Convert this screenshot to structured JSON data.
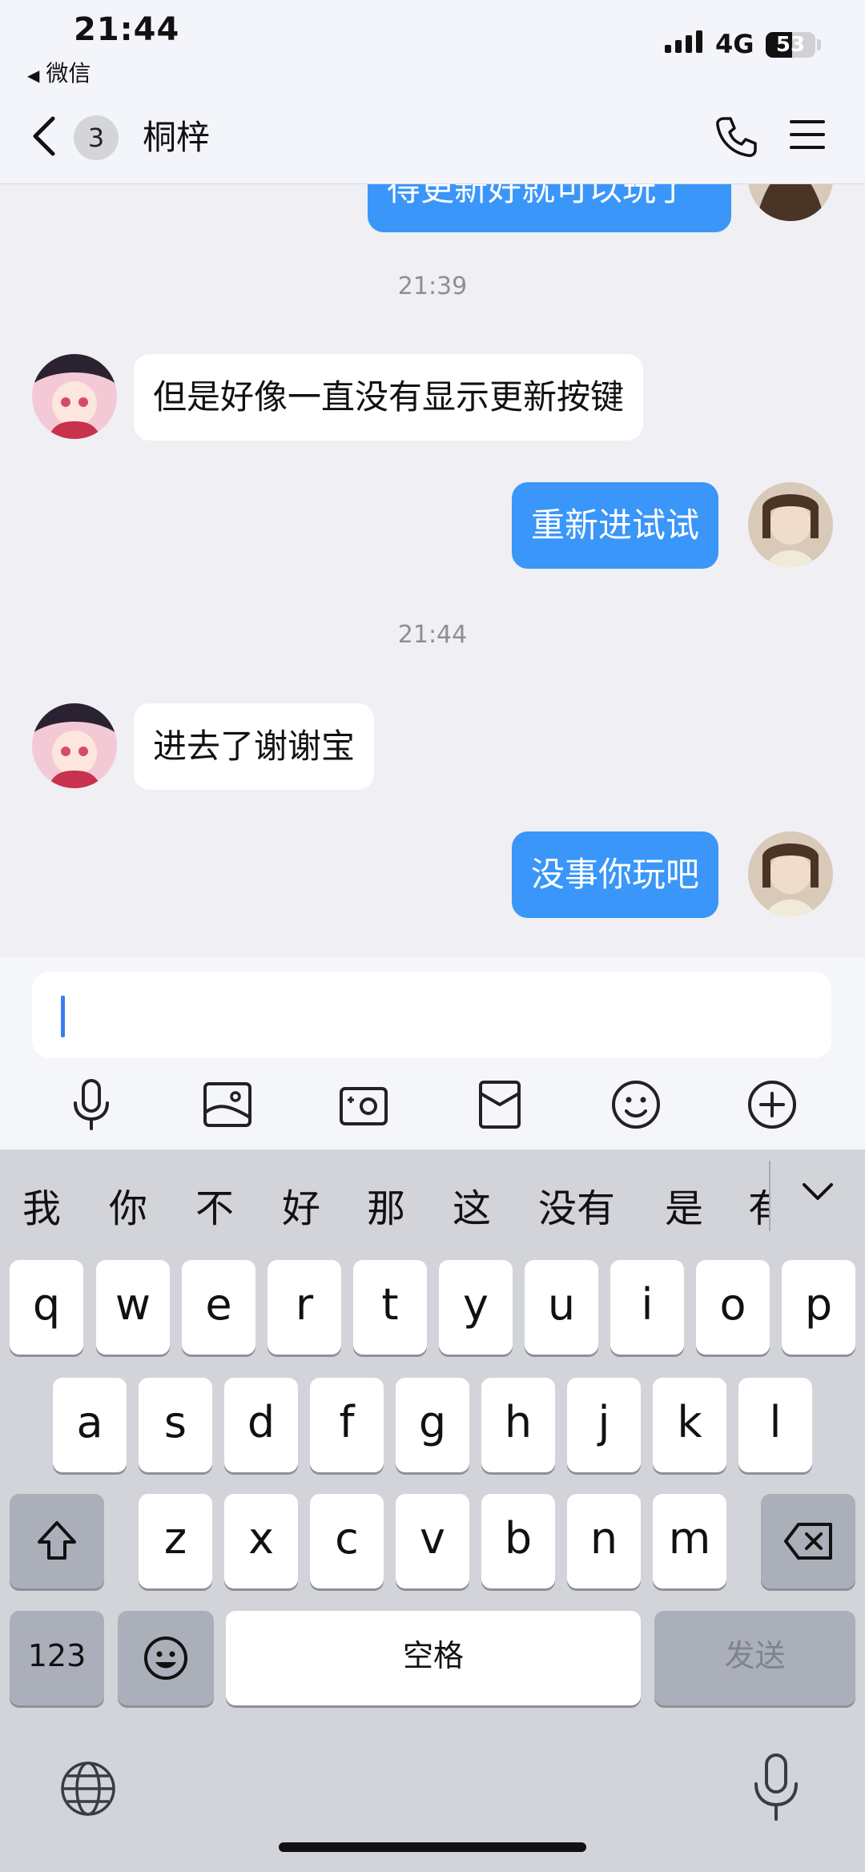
{
  "status_bar": {
    "time": "21:44",
    "back_app": "微信",
    "network": "4G",
    "battery": "53",
    "battery_level": 0.53,
    "signal_bars": 4
  },
  "header": {
    "unread_count": "3",
    "title": "桐梓"
  },
  "messages": {
    "top_partial": "得更新好就可以玩了",
    "ts1": "21:39",
    "m1": "但是好像一直没有显示更新按键",
    "m2": "重新进试试",
    "ts2": "21:44",
    "m3": "进去了谢谢宝",
    "m4": "没事你玩吧"
  },
  "toolbar": {
    "icons": [
      "microphone-icon",
      "image-icon",
      "camera-icon",
      "red-packet-icon",
      "emoji-icon",
      "plus-icon"
    ]
  },
  "keyboard": {
    "candidates": [
      "我",
      "你",
      "不",
      "好",
      "那",
      "这",
      "没有",
      "是",
      "有"
    ],
    "row1": [
      "q",
      "w",
      "e",
      "r",
      "t",
      "y",
      "u",
      "i",
      "o",
      "p"
    ],
    "row2": [
      "a",
      "s",
      "d",
      "f",
      "g",
      "h",
      "j",
      "k",
      "l"
    ],
    "row3": [
      "z",
      "x",
      "c",
      "v",
      "b",
      "n",
      "m"
    ],
    "num_label": "123",
    "space_label": "空格",
    "send_label": "发送"
  },
  "colors": {
    "accent_blue": "#3a96f8",
    "chat_bg": "#efeff4",
    "keyboard_bg": "#d2d4da"
  }
}
